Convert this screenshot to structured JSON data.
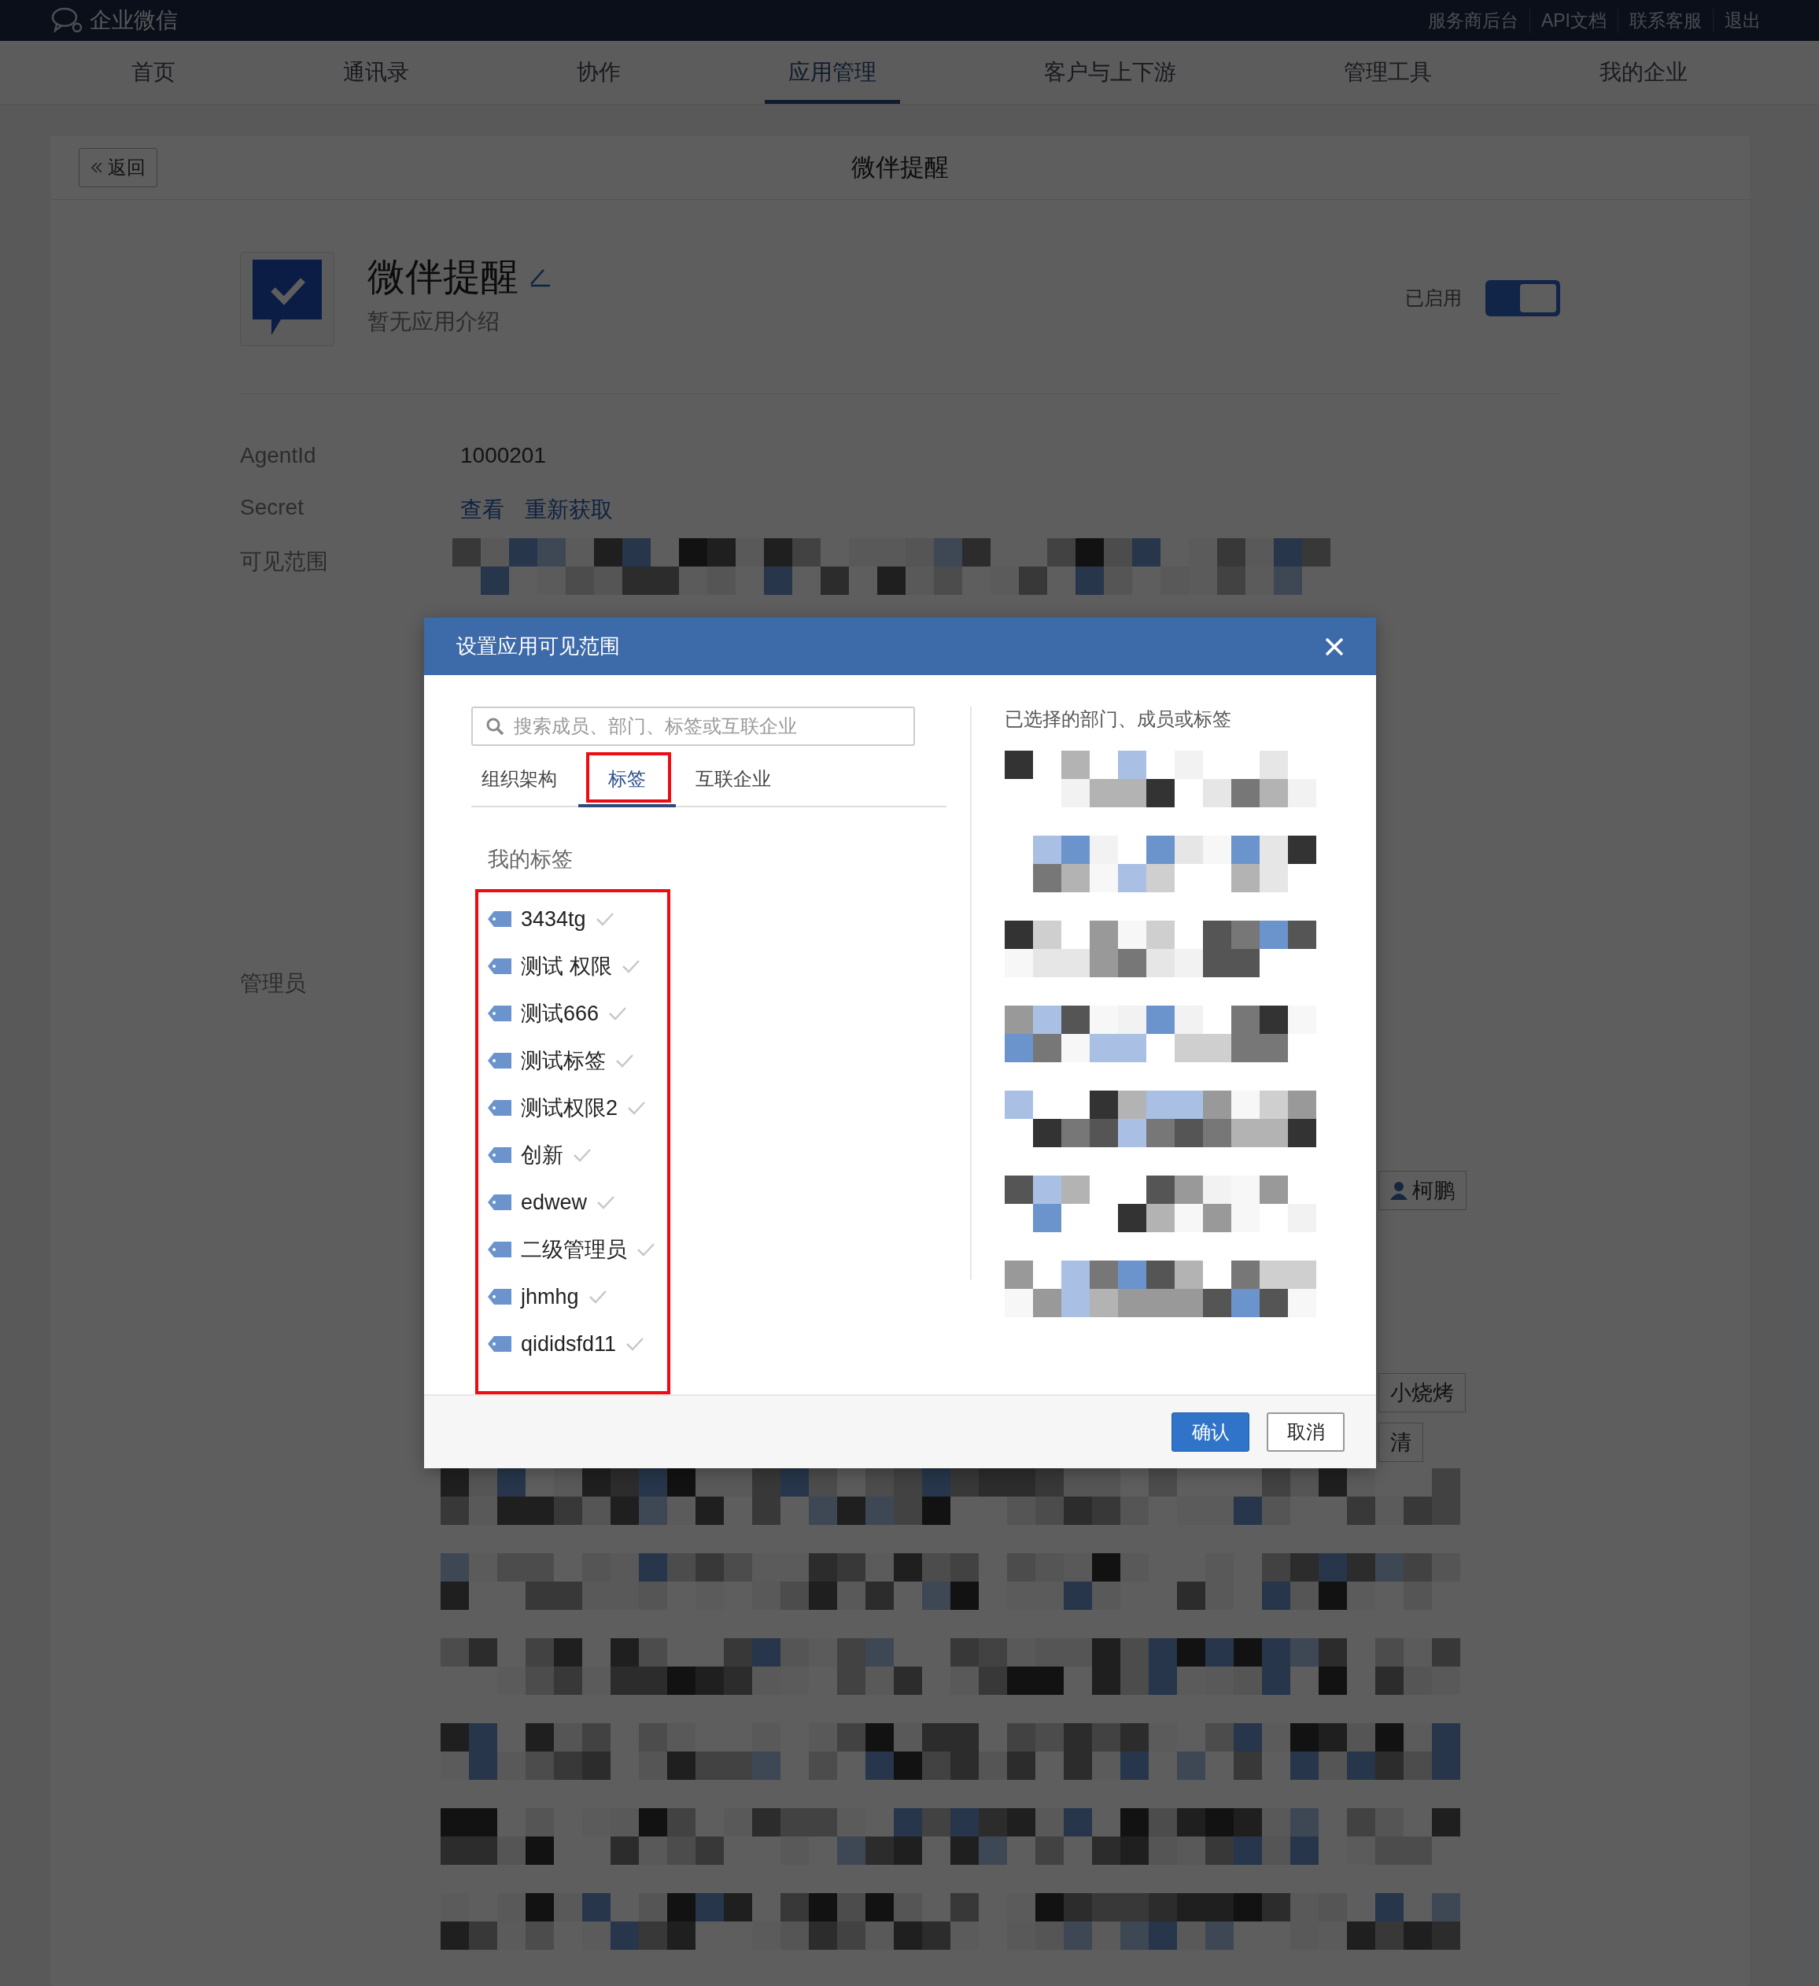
{
  "header": {
    "logo": "企业微信",
    "links": [
      "服务商后台",
      "API文档",
      "联系客服",
      "退出"
    ]
  },
  "nav": [
    {
      "label": "首页",
      "selected": false
    },
    {
      "label": "通讯录",
      "selected": false
    },
    {
      "label": "协作",
      "selected": false
    },
    {
      "label": "应用管理",
      "selected": true
    },
    {
      "label": "客户与上下游",
      "selected": false
    },
    {
      "label": "管理工具",
      "selected": false
    },
    {
      "label": "我的企业",
      "selected": false
    }
  ],
  "page": {
    "back": "返回",
    "title": "微伴提醒"
  },
  "app": {
    "name": "微伴提醒",
    "description": "暂无应用介绍",
    "status_label": "已启用",
    "enabled": true
  },
  "fields": [
    {
      "label": "AgentId",
      "value": "1000201"
    },
    {
      "label": "Secret",
      "links": [
        "查看",
        "重新获取"
      ]
    },
    {
      "label": "可见范围"
    }
  ],
  "admin_label": "管理员",
  "side_chips": [
    {
      "label": "柯鹏",
      "kind": "person"
    },
    {
      "label": "小烧烤",
      "kind": "plain"
    },
    {
      "label": "清",
      "kind": "plain"
    }
  ],
  "dialog": {
    "title": "设置应用可见范围",
    "search": {
      "placeholder": "搜索成员、部门、标签或互联企业"
    },
    "tabs": [
      {
        "label": "组织架构",
        "selected": false,
        "highlighted": false
      },
      {
        "label": "标签",
        "selected": true,
        "highlighted": true
      },
      {
        "label": "互联企业",
        "selected": false,
        "highlighted": false
      }
    ],
    "section_title": "我的标签",
    "tags_highlighted": true,
    "tags": [
      {
        "label": "3434tg",
        "checked": true
      },
      {
        "label": "测试 权限",
        "checked": true
      },
      {
        "label": "测试666",
        "checked": true
      },
      {
        "label": "测试标签",
        "checked": true
      },
      {
        "label": "测试权限2",
        "checked": true
      },
      {
        "label": "创新",
        "checked": true
      },
      {
        "label": "edwew",
        "checked": true
      },
      {
        "label": "二级管理员",
        "checked": true
      },
      {
        "label": "jhmhg",
        "checked": true
      },
      {
        "label": "qididsfd11",
        "checked": true
      }
    ],
    "selected_title": "已选择的部门、成员或标签",
    "buttons": [
      {
        "label": "确认",
        "kind": "primary"
      },
      {
        "label": "取消",
        "kind": "secondary"
      }
    ]
  }
}
